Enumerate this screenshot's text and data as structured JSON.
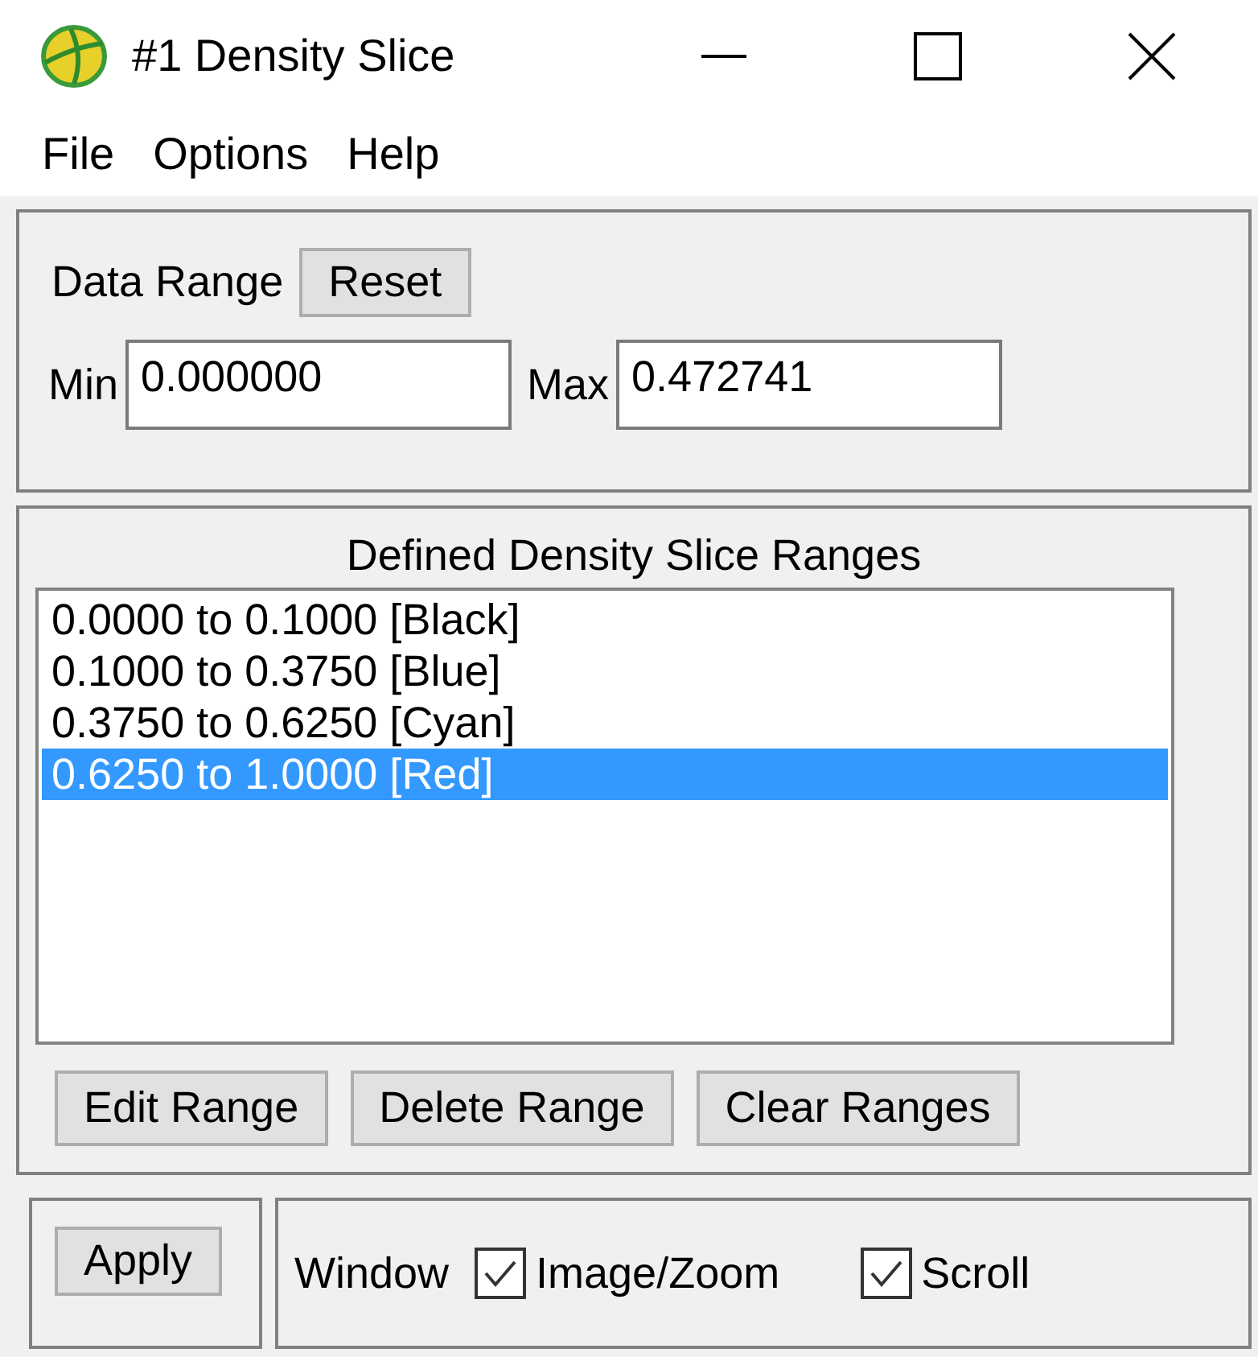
{
  "window": {
    "title": "#1 Density Slice"
  },
  "menu": [
    "File",
    "Options",
    "Help"
  ],
  "data_range": {
    "label": "Data Range",
    "reset": "Reset",
    "min_label": "Min",
    "min": "0.000000",
    "max_label": "Max",
    "max": "0.472741"
  },
  "ranges": {
    "title": "Defined Density Slice Ranges",
    "items": [
      {
        "text": "0.0000 to 0.1000 [Black]",
        "selected": false
      },
      {
        "text": "0.1000 to 0.3750 [Blue]",
        "selected": false
      },
      {
        "text": "0.3750 to 0.6250 [Cyan]",
        "selected": false
      },
      {
        "text": "0.6250 to 1.0000 [Red]",
        "selected": true
      }
    ],
    "buttons": [
      "Edit Range",
      "Delete Range",
      "Clear Ranges"
    ]
  },
  "apply": "Apply",
  "window_options": {
    "label": "Window",
    "options": [
      {
        "label": "Image/Zoom",
        "checked": true
      },
      {
        "label": "Scroll",
        "checked": true
      }
    ]
  }
}
